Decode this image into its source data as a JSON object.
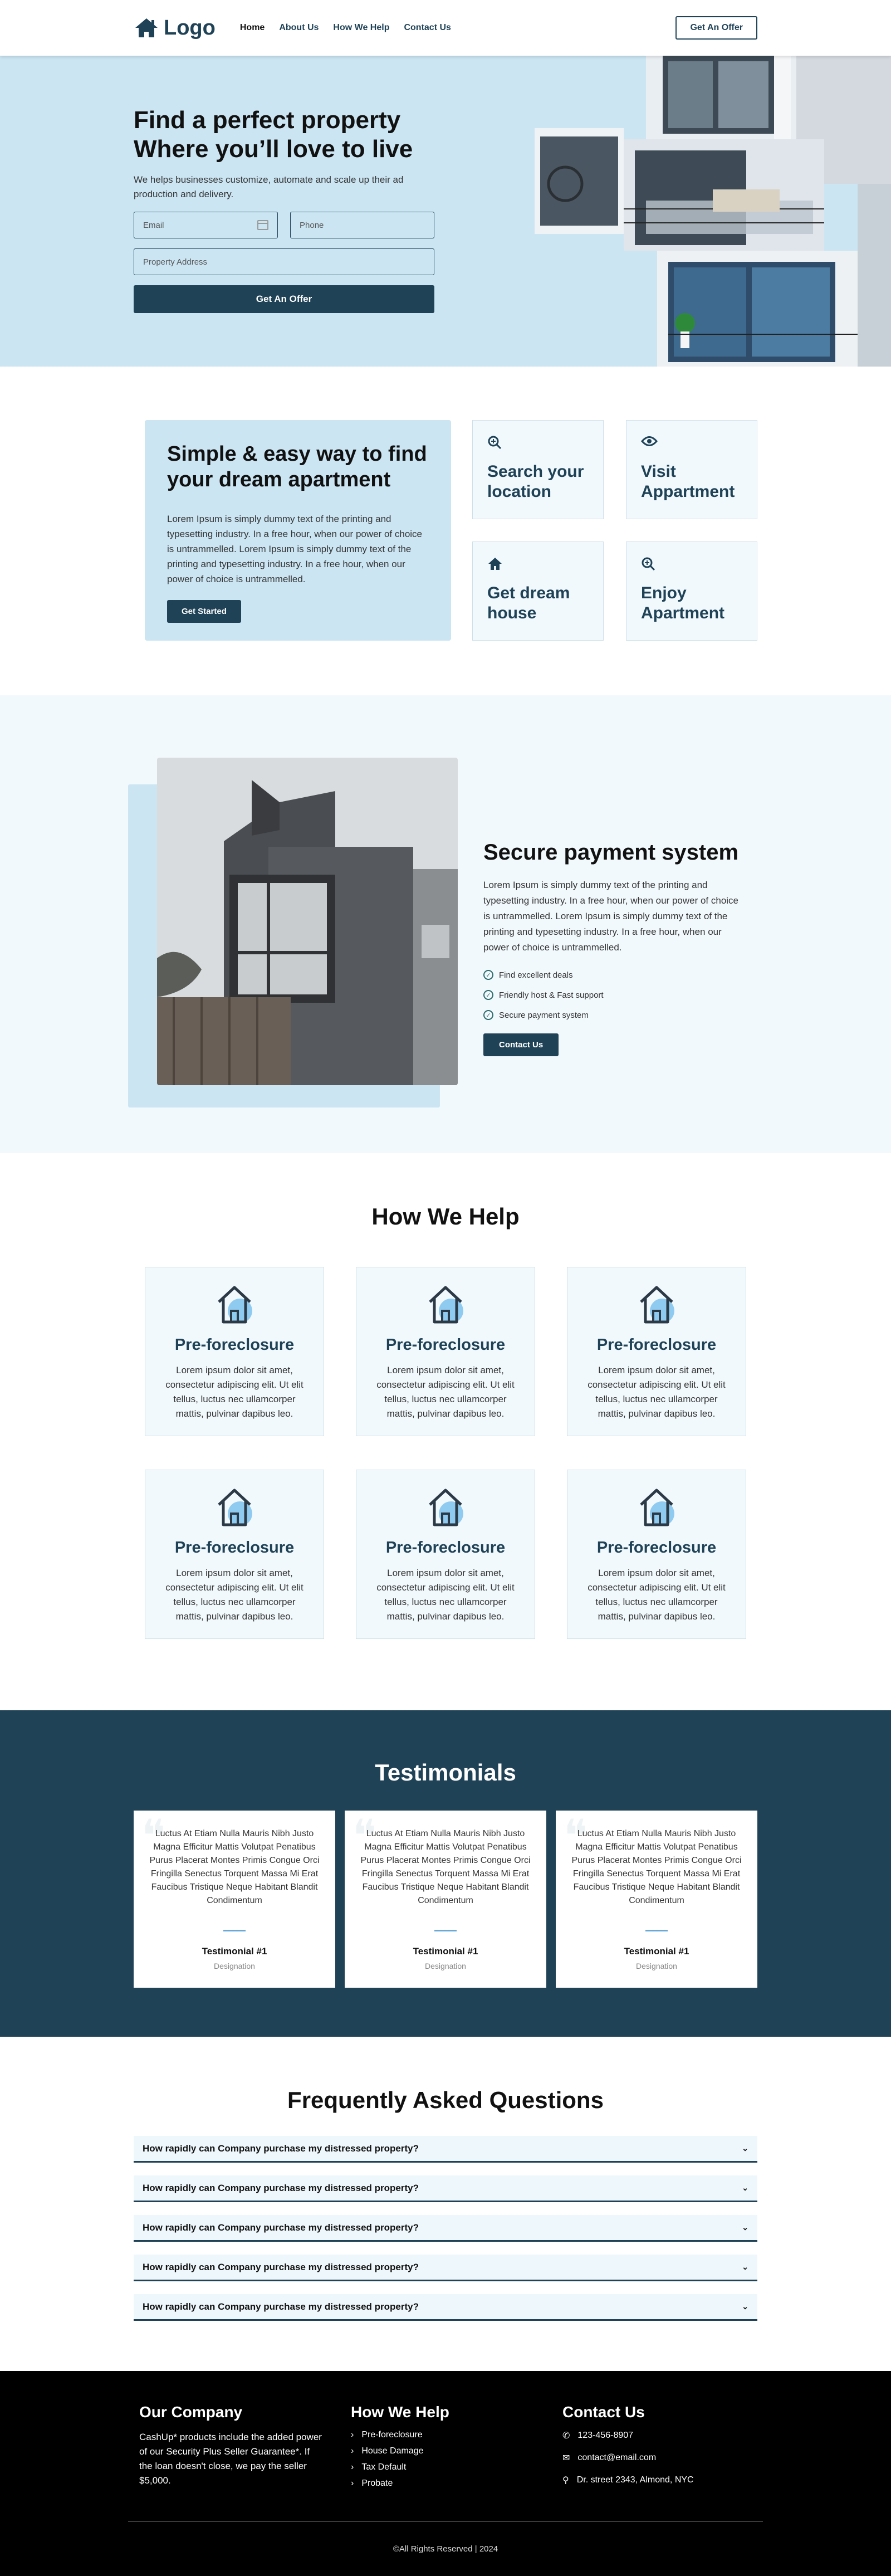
{
  "header": {
    "logo_text": "Logo",
    "nav": [
      "Home",
      "About Us",
      "How We Help",
      "Contact Us"
    ],
    "cta": "Get An Offer"
  },
  "hero": {
    "title_line1": "Find a perfect property",
    "title_line2": "Where you’ll love to live",
    "subtitle": "We helps businesses customize, automate and scale up their ad production and delivery.",
    "email_placeholder": "Email",
    "phone_placeholder": "Phone",
    "address_placeholder": "Property Address",
    "submit": "Get An Offer"
  },
  "simple": {
    "title": "Simple & easy way to find your dream apartment",
    "text": "Lorem Ipsum is simply dummy text of the printing and typesetting industry. In a free hour, when our power of choice is untrammelled. Lorem Ipsum is simply dummy text of the printing and typesetting industry. In a free hour, when our power of choice is untrammelled.",
    "button": "Get Started",
    "features": [
      {
        "icon": "search-icon",
        "label": "Search your location"
      },
      {
        "icon": "eye-icon",
        "label": "Visit Appartment"
      },
      {
        "icon": "home-icon",
        "label": "Get dream house"
      },
      {
        "icon": "search-icon",
        "label": "Enjoy Apartment"
      }
    ]
  },
  "secure": {
    "title": "Secure payment system",
    "text": "Lorem Ipsum is simply dummy text of the printing and typesetting industry. In a free hour, when our power of choice is untrammelled. Lorem Ipsum is simply dummy text of the printing and typesetting industry. In a free hour, when our power of choice is untrammelled.",
    "checks": [
      "Find excellent deals",
      "Friendly host & Fast support",
      "Secure payment system"
    ],
    "button": "Contact Us"
  },
  "help": {
    "title": "How We Help",
    "cards": [
      {
        "title": "Pre-foreclosure",
        "text": "Lorem ipsum dolor sit amet, consectetur adipiscing elit. Ut elit tellus, luctus nec ullamcorper mattis, pulvinar dapibus leo."
      },
      {
        "title": "Pre-foreclosure",
        "text": "Lorem ipsum dolor sit amet, consectetur adipiscing elit. Ut elit tellus, luctus nec ullamcorper mattis, pulvinar dapibus leo."
      },
      {
        "title": "Pre-foreclosure",
        "text": "Lorem ipsum dolor sit amet, consectetur adipiscing elit. Ut elit tellus, luctus nec ullamcorper mattis, pulvinar dapibus leo."
      },
      {
        "title": "Pre-foreclosure",
        "text": "Lorem ipsum dolor sit amet, consectetur adipiscing elit. Ut elit tellus, luctus nec ullamcorper mattis, pulvinar dapibus leo."
      },
      {
        "title": "Pre-foreclosure",
        "text": "Lorem ipsum dolor sit amet, consectetur adipiscing elit. Ut elit tellus, luctus nec ullamcorper mattis, pulvinar dapibus leo."
      },
      {
        "title": "Pre-foreclosure",
        "text": "Lorem ipsum dolor sit amet, consectetur adipiscing elit. Ut elit tellus, luctus nec ullamcorper mattis, pulvinar dapibus leo."
      }
    ]
  },
  "testimonials": {
    "title": "Testimonials",
    "items": [
      {
        "text": "Luctus At Etiam Nulla Mauris Nibh Justo Magna Efficitur Mattis Volutpat Penatibus Purus Placerat Montes Primis Congue Orci Fringilla Senectus Torquent Massa Mi Erat Faucibus Tristique Neque Habitant Blandit Condimentum",
        "name": "Testimonial #1",
        "designation": "Designation"
      },
      {
        "text": "Luctus At Etiam Nulla Mauris Nibh Justo Magna Efficitur Mattis Volutpat Penatibus Purus Placerat Montes Primis Congue Orci Fringilla Senectus Torquent Massa Mi Erat Faucibus Tristique Neque Habitant Blandit Condimentum",
        "name": "Testimonial #1",
        "designation": "Designation"
      },
      {
        "text": "Luctus At Etiam Nulla Mauris Nibh Justo Magna Efficitur Mattis Volutpat Penatibus Purus Placerat Montes Primis Congue Orci Fringilla Senectus Torquent Massa Mi Erat Faucibus Tristique Neque Habitant Blandit Condimentum",
        "name": "Testimonial #1",
        "designation": "Designation"
      }
    ]
  },
  "faq": {
    "title": "Frequently Asked Questions",
    "items": [
      "How rapidly can Company purchase my distressed property?",
      "How rapidly can Company purchase my distressed property?",
      "How rapidly can Company purchase my distressed property?",
      "How rapidly can Company purchase my distressed property?",
      "How rapidly can Company purchase my distressed property?"
    ]
  },
  "footer": {
    "company_title": "Our Company",
    "company_text": "CashUp* products include the added power of our Security Plus Seller Guarantee*. If the loan doesn't close, we pay the seller $5,000.",
    "help_title": "How We Help",
    "help_links": [
      "Pre-foreclosure",
      "House Damage",
      "Tax Default",
      "Probate"
    ],
    "contact_title": "Contact Us",
    "phone": "123-456-8907",
    "email": "contact@email.com",
    "address": "Dr. street 2343, Almond, NYC",
    "copyright": "©All Rights Reserved | 2024"
  },
  "colors": {
    "primary": "#1f4257",
    "light_blue": "#cbe5f3",
    "pale_blue": "#f2f9fd"
  }
}
